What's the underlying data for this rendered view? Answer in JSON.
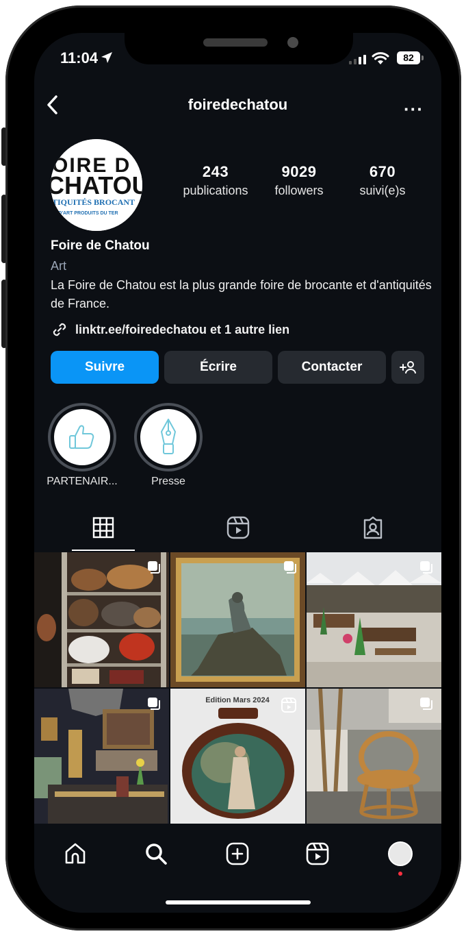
{
  "status_bar": {
    "time": "11:04",
    "battery": "82"
  },
  "header": {
    "username": "foiredechatou",
    "more_label": "···"
  },
  "avatar": {
    "line1": "OIRE D",
    "line2": "CHATOU",
    "line3": "TIQUITÉS BROCANT",
    "line4": "ES D'ART  PRODUITS DU TER"
  },
  "stats": [
    {
      "value": "243",
      "label": "publications"
    },
    {
      "value": "9029",
      "label": "followers"
    },
    {
      "value": "670",
      "label": "suivi(e)s"
    }
  ],
  "profile": {
    "name": "Foire de Chatou",
    "category": "Art",
    "bio": "La Foire de Chatou est la plus grande foire de brocante et d'antiquités de France.",
    "link": "linktr.ee/foiredechatou et 1 autre lien"
  },
  "buttons": {
    "follow": "Suivre",
    "message": "Écrire",
    "contact": "Contacter",
    "add_person": "+♂"
  },
  "highlights": [
    {
      "label": "PARTENAIR...",
      "icon": "thumbs-up-icon"
    },
    {
      "label": "Presse",
      "icon": "fountain-pen-icon"
    }
  ],
  "tabs": [
    "grid-icon",
    "reels-icon",
    "tagged-icon"
  ],
  "posts": [
    {
      "type": "carousel",
      "subject": "bags shelf"
    },
    {
      "type": "carousel",
      "subject": "painting woman on rock"
    },
    {
      "type": "carousel",
      "subject": "outdoor fair tents"
    },
    {
      "type": "carousel",
      "subject": "antique interior"
    },
    {
      "type": "reel",
      "subject": "vase",
      "caption": "Edition Mars 2024"
    },
    {
      "type": "carousel",
      "subject": "rattan chair"
    }
  ],
  "colors": {
    "background": "#0c0f14",
    "primary_button": "#0a95f6",
    "secondary_button": "#262a30",
    "category_text": "#9aa5b6",
    "notification_dot": "#ff3040"
  }
}
